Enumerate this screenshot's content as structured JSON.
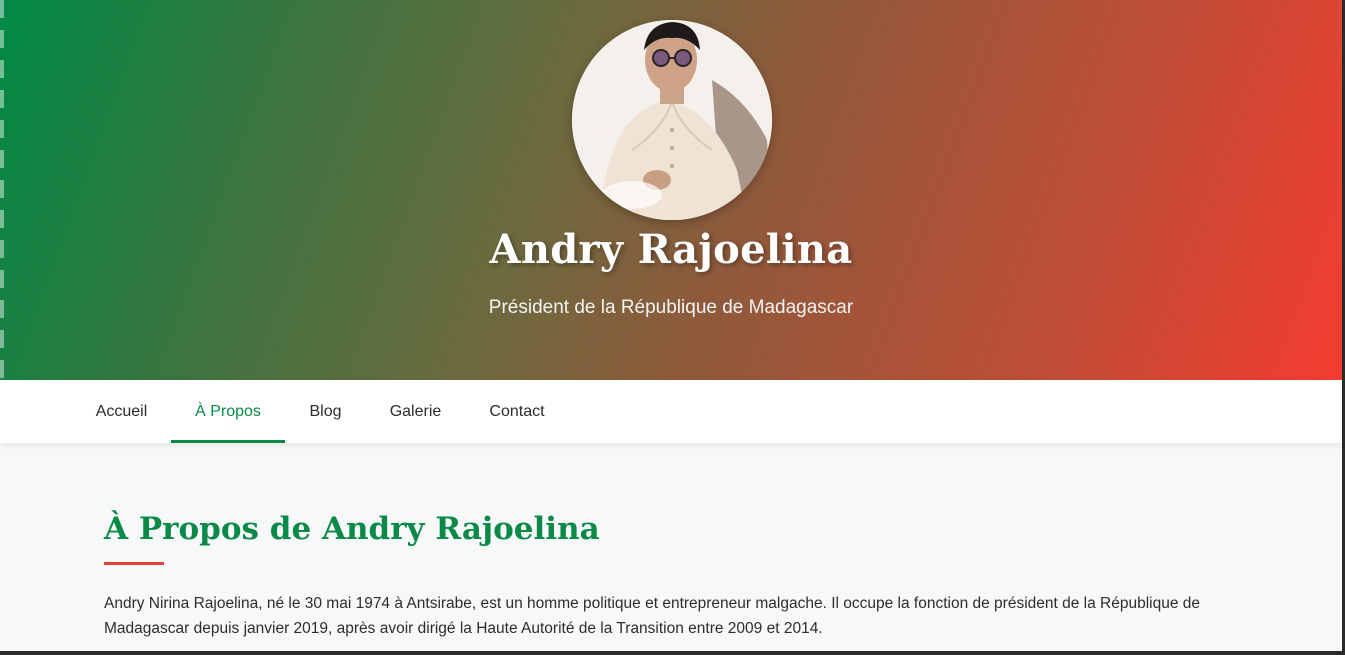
{
  "hero": {
    "name": "Andry Rajoelina",
    "subtitle": "Président de la République de Madagascar",
    "gradient_start": "#008a45",
    "gradient_end": "#f43c30",
    "avatar_alt": "Portrait d'Andry Rajoelina"
  },
  "nav": {
    "items": [
      {
        "label": "Accueil",
        "active": false
      },
      {
        "label": "À Propos",
        "active": true
      },
      {
        "label": "Blog",
        "active": false
      },
      {
        "label": "Galerie",
        "active": false
      },
      {
        "label": "Contact",
        "active": false
      }
    ],
    "accent_color": "#0a8a46"
  },
  "about": {
    "title": "À Propos de Andry Rajoelina",
    "underline_color": "#e4412f",
    "paragraph": "Andry Nirina Rajoelina, né le 30 mai 1974 à Antsirabe, est un homme politique et entrepreneur malgache. Il occupe la fonction de président de la République de Madagascar depuis janvier 2019, après avoir dirigé la Haute Autorité de la Transition entre 2009 et 2014."
  }
}
